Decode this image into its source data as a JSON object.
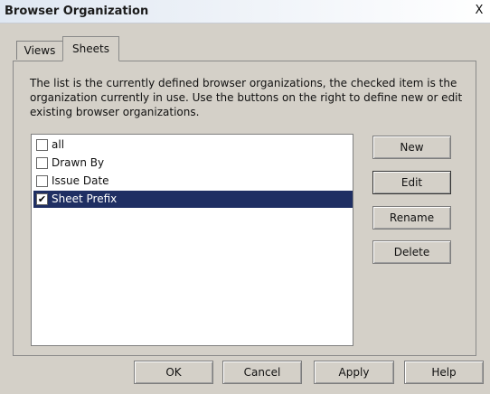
{
  "window": {
    "title": "Browser Organization",
    "close_label": "X"
  },
  "tabs": [
    {
      "label": "Views"
    },
    {
      "label": "Sheets"
    }
  ],
  "description": "The list is the currently defined browser organizations,  the checked item is the organization currently in use. Use the buttons on the right to define new or edit existing browser organizations.",
  "organizations": [
    {
      "label": "all",
      "checked": false,
      "selected": false
    },
    {
      "label": "Drawn By",
      "checked": false,
      "selected": false
    },
    {
      "label": "Issue Date",
      "checked": false,
      "selected": false
    },
    {
      "label": "Sheet Prefix",
      "checked": true,
      "selected": true
    }
  ],
  "buttons": {
    "new": "New",
    "edit": "Edit",
    "rename": "Rename",
    "delete": "Delete",
    "ok": "OK",
    "cancel": "Cancel",
    "apply": "Apply",
    "help": "Help"
  }
}
